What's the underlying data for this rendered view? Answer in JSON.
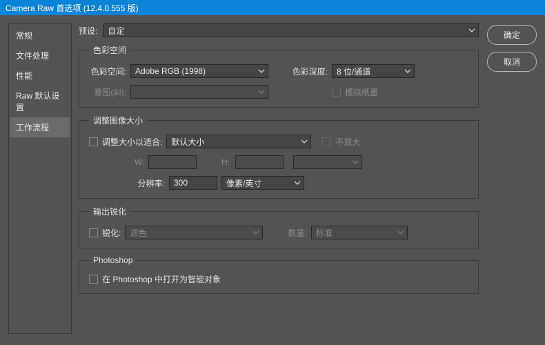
{
  "title": "Camera Raw 首选项  (12.4.0.555 版)",
  "buttons": {
    "ok": "确定",
    "cancel": "取消"
  },
  "sidebar": {
    "items": [
      {
        "label": "常规"
      },
      {
        "label": "文件处理"
      },
      {
        "label": "性能"
      },
      {
        "label": "Raw 默认设置"
      },
      {
        "label": "工作流程"
      }
    ]
  },
  "preset": {
    "label": "预设:",
    "value": "自定"
  },
  "colorSpace": {
    "legend": "色彩空间",
    "spaceLabel": "色彩空间:",
    "spaceValue": "Adobe RGB (1998)",
    "depthLabel": "色彩深度:",
    "depthValue": "8 位/通道",
    "intentLabel": "意图(&I):",
    "intentValue": "",
    "simulatePaper": "模拟纸墨"
  },
  "resize": {
    "legend": "调整图像大小",
    "fitLabel": "调整大小以适合:",
    "fitValue": "默认大小",
    "noEnlarge": "不放大",
    "wLabel": "W:",
    "wValue": "",
    "hLabel": "H:",
    "hValue": "",
    "resLabel": "分辨率:",
    "resValue": "300",
    "resUnit": "像素/英寸"
  },
  "sharpen": {
    "legend": "输出锐化",
    "sharpenLabel": "锐化:",
    "sharpenValue": "滤色",
    "amountLabel": "数量:",
    "amountValue": "标准"
  },
  "photoshop": {
    "legend": "Photoshop",
    "openAsSmart": "在 Photoshop 中打开为智能对象"
  }
}
